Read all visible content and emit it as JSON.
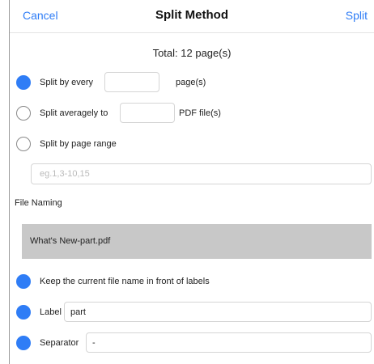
{
  "navbar": {
    "cancel_label": "Cancel",
    "title": "Split Method",
    "split_label": "Split"
  },
  "total_text": "Total: 12 page(s)",
  "options": {
    "every": {
      "selected": true,
      "prefix": "Split by every",
      "value": "",
      "suffix": "page(s)"
    },
    "average": {
      "selected": false,
      "prefix": "Split averagely to",
      "value": "",
      "suffix": "PDF file(s)"
    },
    "range": {
      "selected": false,
      "label": "Split by page range",
      "value": "",
      "placeholder": "eg.1,3-10,15"
    }
  },
  "file_naming": {
    "title": "File Naming",
    "preview": "What's New-part.pdf",
    "keep_name": {
      "selected": true,
      "label": "Keep the current file name in front of labels"
    },
    "label_option": {
      "selected": true,
      "label": "Label",
      "value": "part"
    },
    "separator_option": {
      "selected": true,
      "label": "Separator",
      "value": "-"
    }
  },
  "colors": {
    "accent": "#2f7df6",
    "preview_bg": "#c8c8c8"
  }
}
